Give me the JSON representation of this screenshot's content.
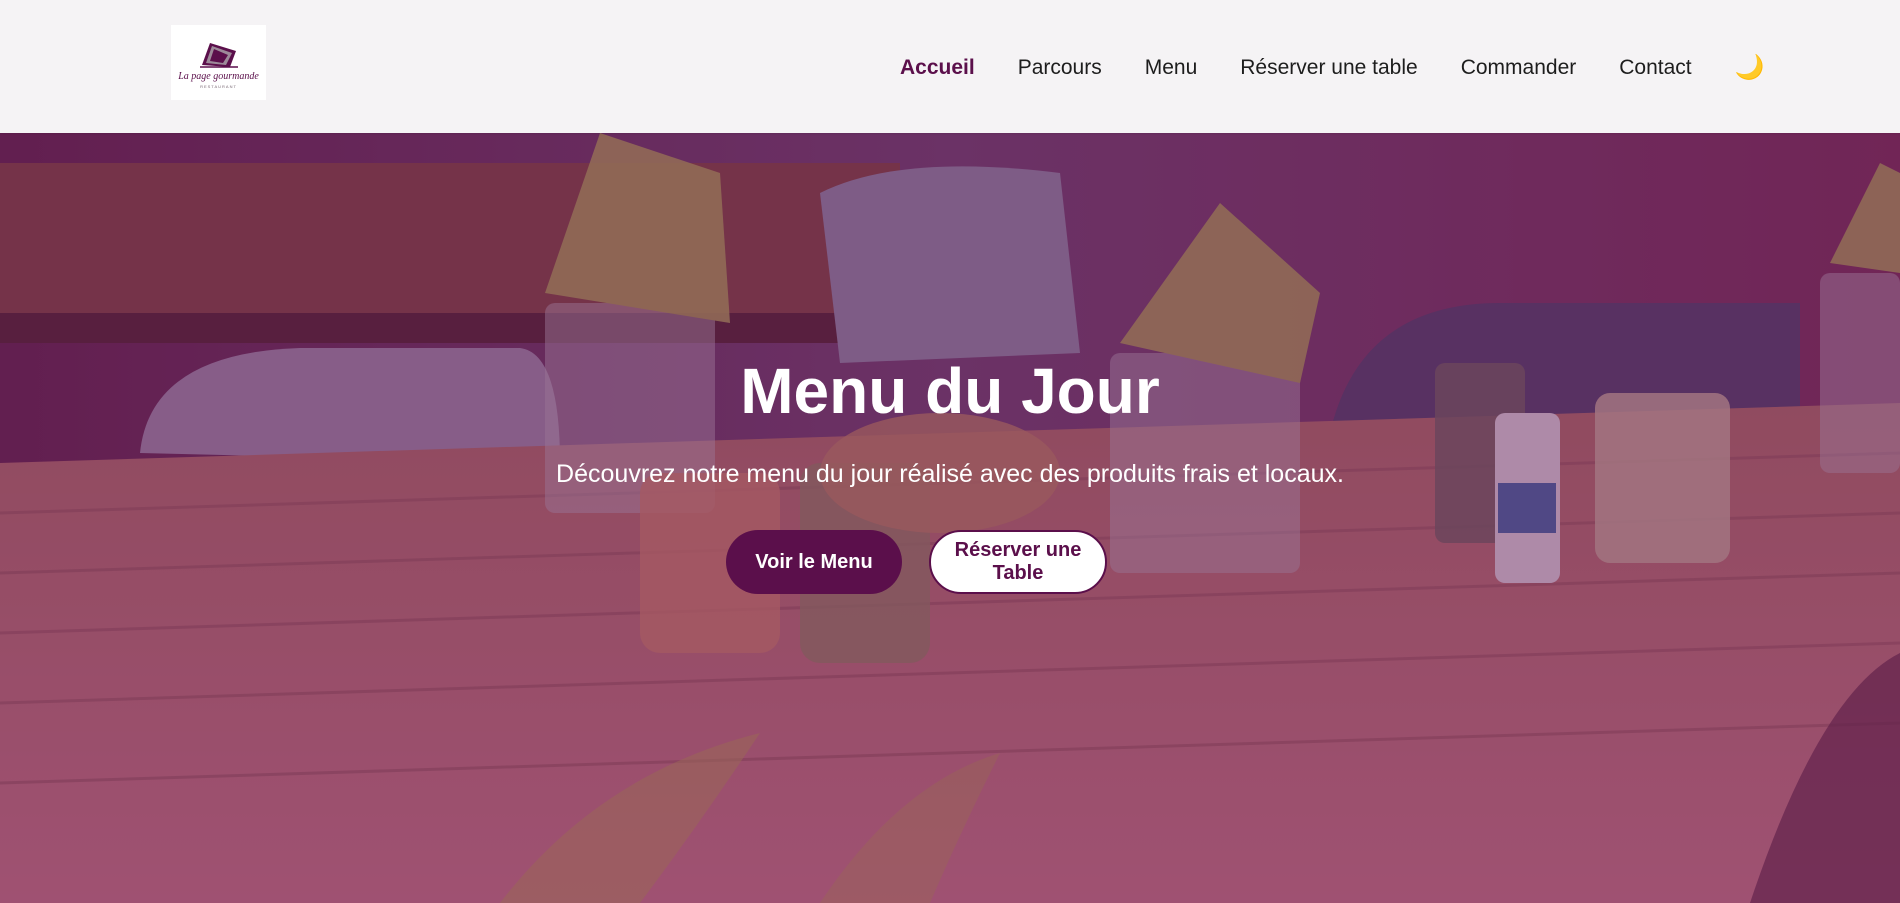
{
  "brand": {
    "name": "La page gourmande",
    "tagline": "RESTAURANT"
  },
  "nav": {
    "items": [
      {
        "label": "Accueil",
        "active": true
      },
      {
        "label": "Parcours",
        "active": false
      },
      {
        "label": "Menu",
        "active": false
      },
      {
        "label": "Réserver une table",
        "active": false
      },
      {
        "label": "Commander",
        "active": false
      },
      {
        "label": "Contact",
        "active": false
      }
    ],
    "theme_toggle_icon": "moon-icon",
    "theme_toggle_glyph": "🌙"
  },
  "hero": {
    "title": "Menu du Jour",
    "subtitle": "Découvrez notre menu du jour réalisé avec des produits frais et locaux.",
    "primary_button": "Voir le Menu",
    "secondary_button": "Réserver une Table"
  },
  "colors": {
    "brand_purple": "#5b0f4b",
    "header_bg": "#f5f3f5",
    "overlay": "#550f48"
  }
}
